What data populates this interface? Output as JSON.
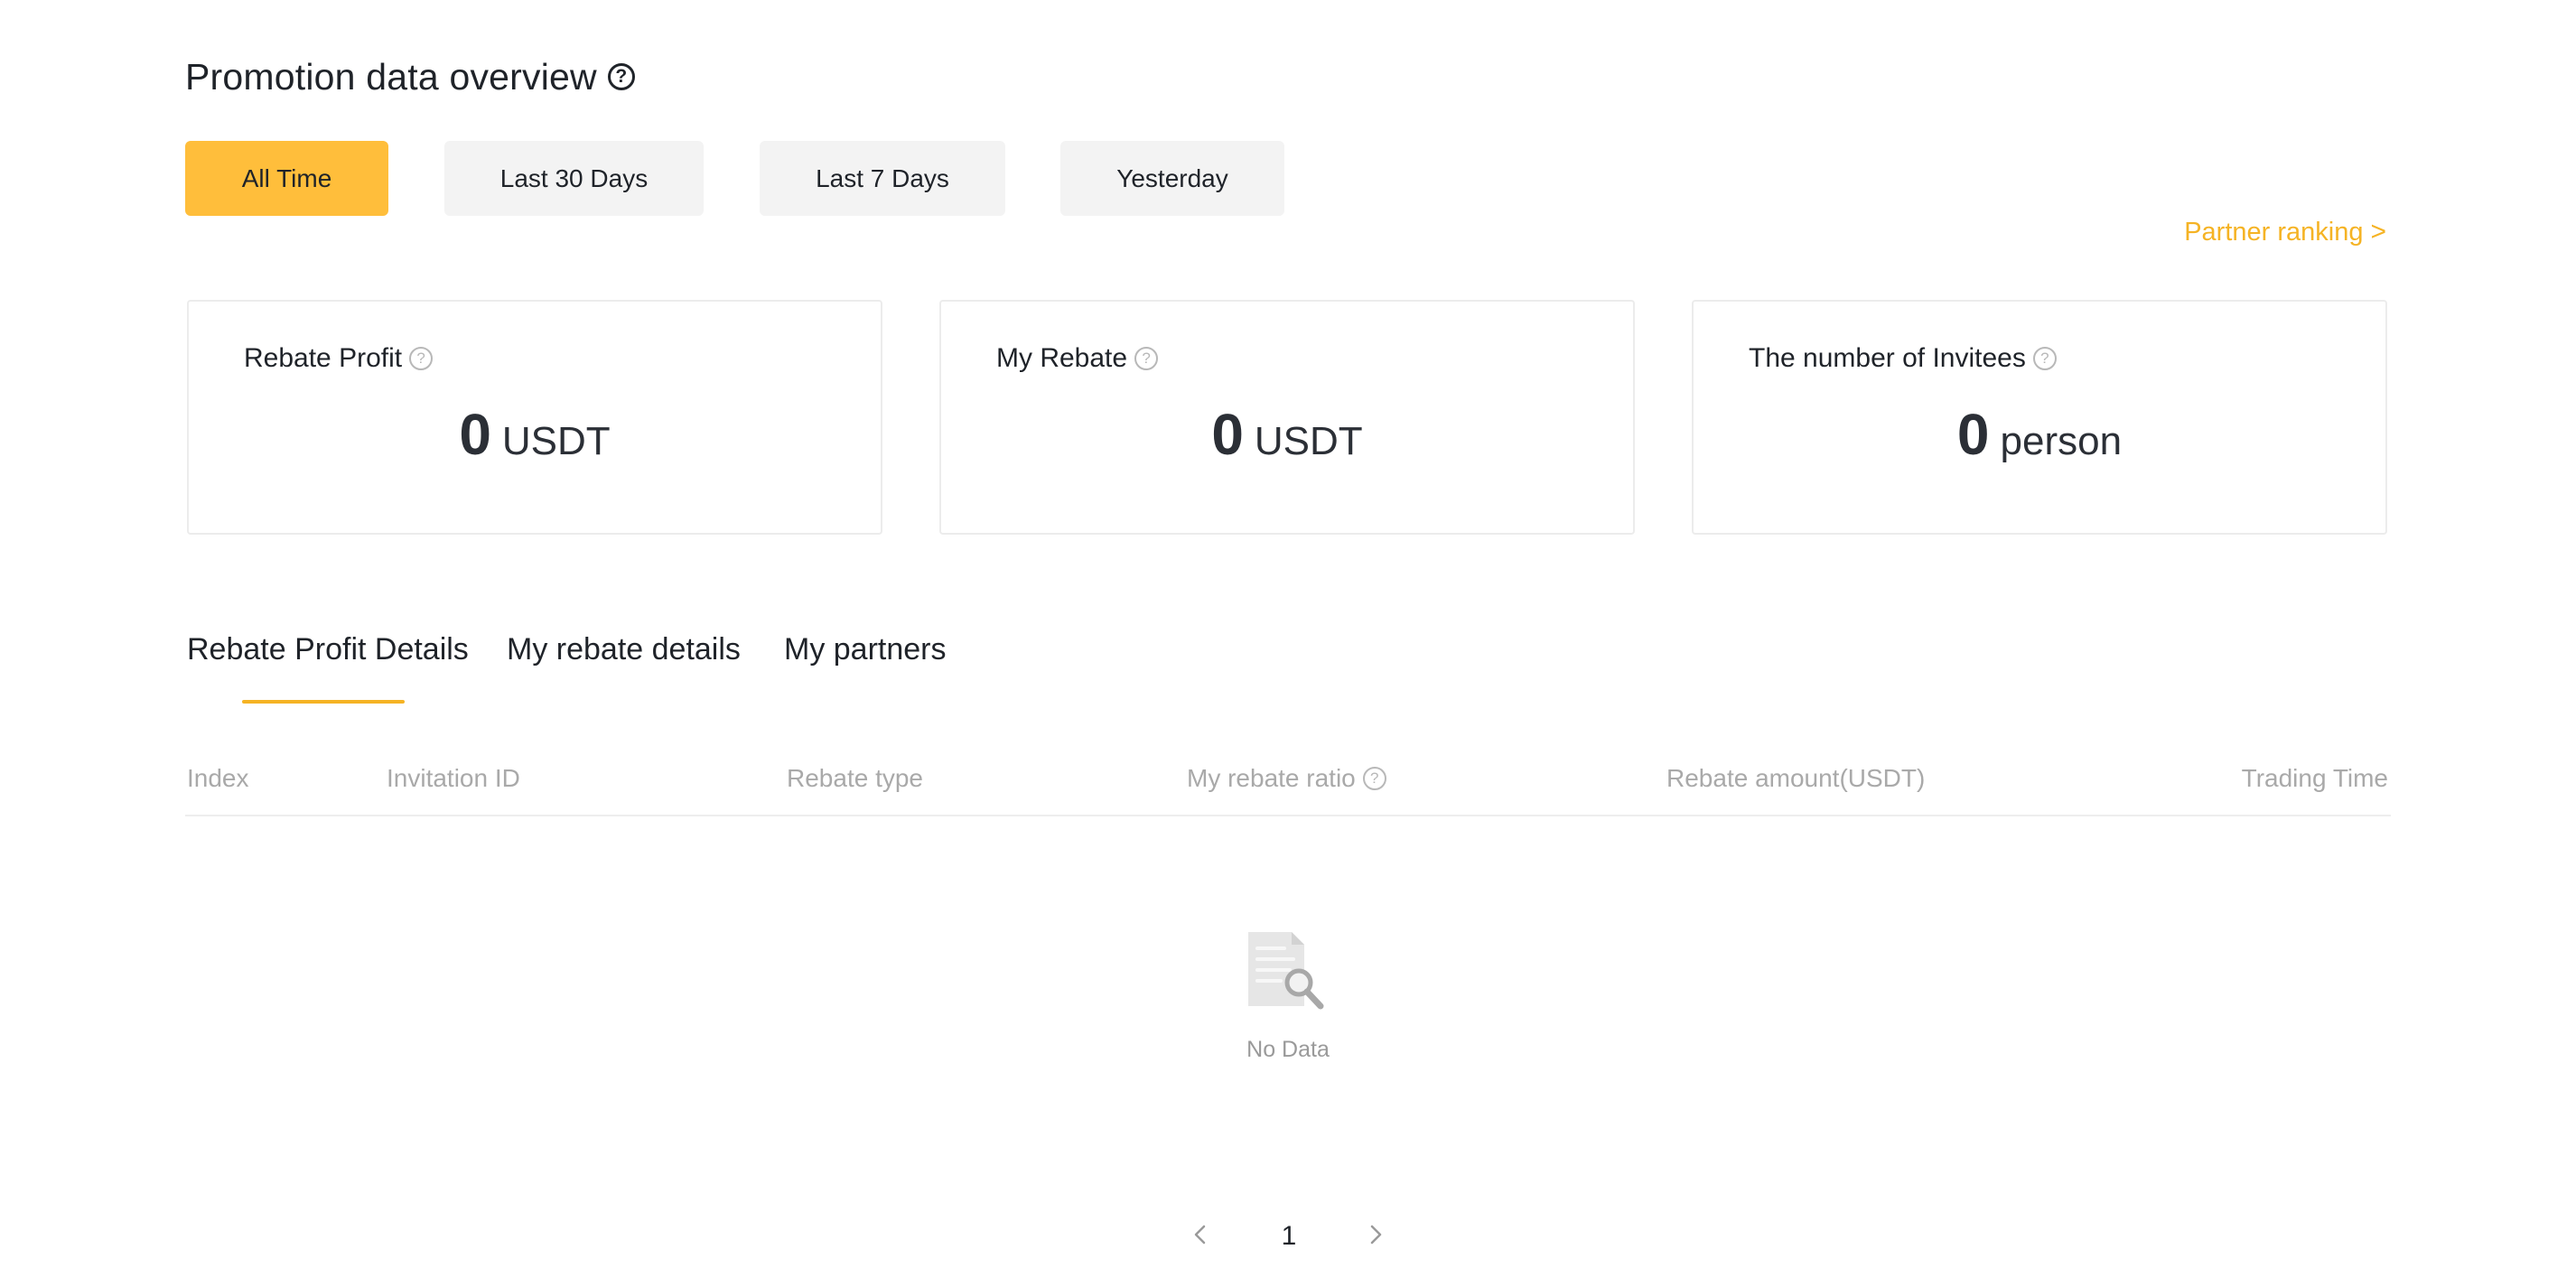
{
  "header": {
    "title": "Promotion data overview",
    "help_icon": "question-circle-icon"
  },
  "periods": {
    "active": "All Time",
    "items": [
      "All Time",
      "Last 30 Days",
      "Last 7 Days",
      "Yesterday"
    ]
  },
  "partner_ranking": {
    "label": "Partner ranking",
    "chevron": ">"
  },
  "stats": [
    {
      "label": "Rebate Profit",
      "value": "0",
      "unit": "USDT"
    },
    {
      "label": "My Rebate",
      "value": "0",
      "unit": "USDT"
    },
    {
      "label": "The number of Invitees",
      "value": "0",
      "unit": "person"
    }
  ],
  "detail_tabs": {
    "active": "Rebate Profit Details",
    "items": [
      "Rebate Profit Details",
      "My rebate details",
      "My partners"
    ]
  },
  "table": {
    "columns": [
      "Index",
      "Invitation ID",
      "Rebate type",
      "My rebate ratio",
      "Rebate amount(USDT)",
      "Trading Time"
    ],
    "rows": [],
    "empty_text": "No Data",
    "empty_icon": "document-search-icon"
  },
  "pagination": {
    "current_page": "1",
    "prev_icon": "chevron-left-icon",
    "next_icon": "chevron-right-icon"
  },
  "colors": {
    "accent": "#ffbe3b",
    "link": "#f5b324",
    "muted_text": "#a9a9a9",
    "button_bg": "#f3f3f3"
  }
}
